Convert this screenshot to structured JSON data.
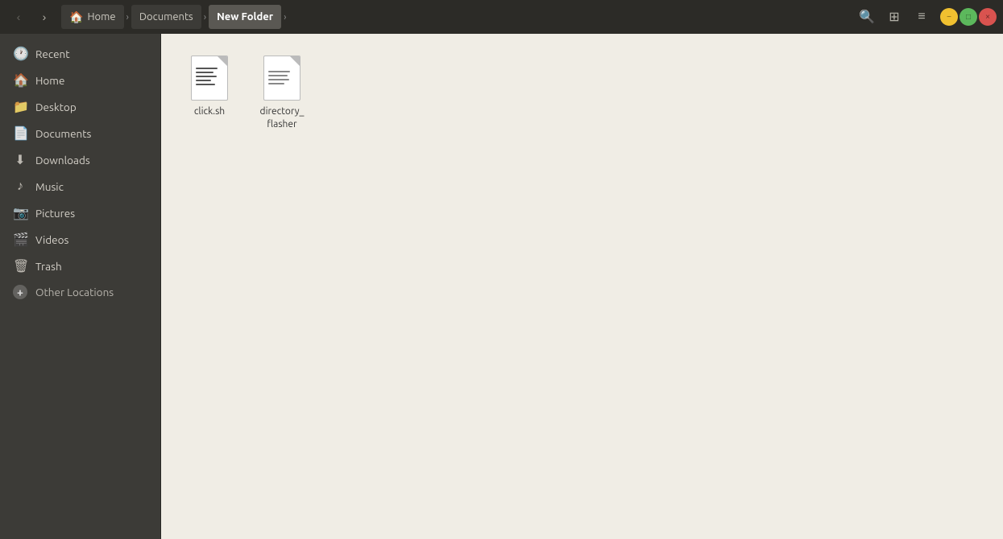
{
  "titlebar": {
    "back_btn": "‹",
    "forward_btn": "›",
    "up_btn": "⌃",
    "breadcrumbs": [
      {
        "id": "home",
        "label": "Home",
        "icon": "🏠",
        "active": false
      },
      {
        "id": "documents",
        "label": "Documents",
        "active": false
      },
      {
        "id": "new-folder",
        "label": "New Folder",
        "active": true
      }
    ],
    "next_arrow": "›",
    "search_icon": "🔍",
    "view_toggle_icon": "⊞",
    "menu_icon": "≡",
    "window_controls": {
      "minimize": "−",
      "maximize": "□",
      "close": "×"
    }
  },
  "sidebar": {
    "items": [
      {
        "id": "recent",
        "label": "Recent",
        "icon": "🕐"
      },
      {
        "id": "home",
        "label": "Home",
        "icon": "🏠"
      },
      {
        "id": "desktop",
        "label": "Desktop",
        "icon": "📁"
      },
      {
        "id": "documents",
        "label": "Documents",
        "icon": "📄"
      },
      {
        "id": "downloads",
        "label": "Downloads",
        "icon": "⬇"
      },
      {
        "id": "music",
        "label": "Music",
        "icon": "♪"
      },
      {
        "id": "pictures",
        "label": "Pictures",
        "icon": "📷"
      },
      {
        "id": "videos",
        "label": "Videos",
        "icon": "🎬"
      },
      {
        "id": "trash",
        "label": "Trash",
        "icon": "🗑"
      }
    ],
    "other_locations": {
      "label": "Other Locations",
      "icon": "+"
    }
  },
  "files": [
    {
      "id": "click-sh",
      "name": "click.sh",
      "type": "shell"
    },
    {
      "id": "directory-flasher",
      "name": "directory_\nflasher",
      "type": "text"
    }
  ]
}
